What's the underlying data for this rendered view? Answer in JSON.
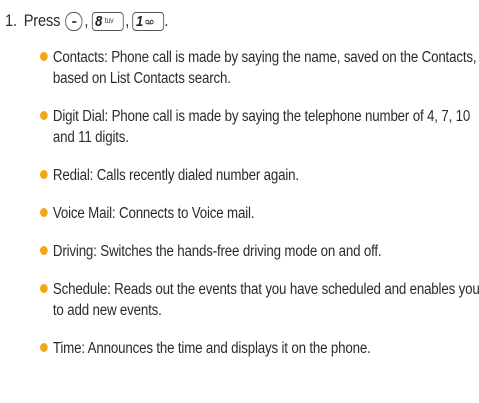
{
  "step": {
    "number": "1.",
    "verb": "Press",
    "sep1": ",",
    "sep2": ",",
    "end": ".",
    "keys": [
      {
        "icon": "minus-soft-key"
      },
      {
        "digit": "8",
        "letters": "tuv"
      },
      {
        "digit": "1",
        "letters": "oo"
      }
    ]
  },
  "accent_color": "#f2a516",
  "bullets": [
    "Contacts: Phone call is made by saying the name, saved on the Contacts, based on List Contacts search.",
    "Digit Dial: Phone call is made by saying the telephone number of 4, 7, 10 and 11 digits.",
    "Redial: Calls recently dialed number again.",
    "Voice Mail: Connects to Voice mail.",
    "Driving: Switches the hands-free driving mode on and off.",
    "Schedule: Reads out the events that you have scheduled and enables you to add new events.",
    "Time: Announces the time and displays it on the phone."
  ]
}
